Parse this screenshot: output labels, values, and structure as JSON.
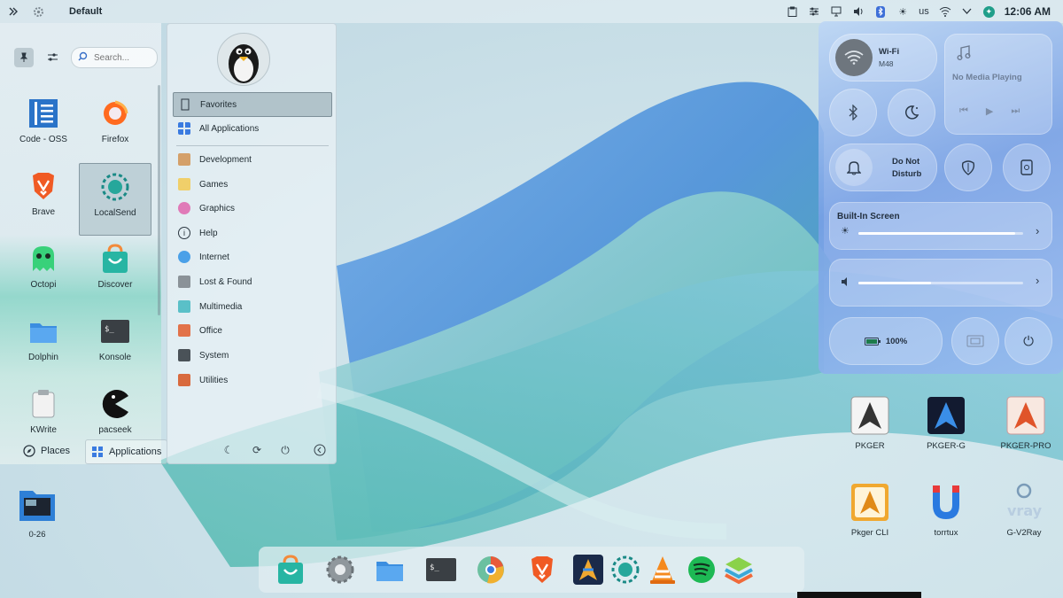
{
  "topbar": {
    "title": "Default",
    "keyboard_layout": "us",
    "clock": "12:06 AM",
    "icons": [
      "clipboard-icon",
      "equalizer-icon",
      "display-icon",
      "volume-icon",
      "bluetooth-icon",
      "brightness-icon",
      "wifi-icon",
      "chevron-down-icon",
      "user-badge-icon"
    ]
  },
  "launcher": {
    "search_placeholder": "Search...",
    "apps": [
      {
        "label": "Code - OSS",
        "icon": "code-oss-icon"
      },
      {
        "label": "Firefox",
        "icon": "firefox-icon"
      },
      {
        "label": "Brave",
        "icon": "brave-icon"
      },
      {
        "label": "LocalSend",
        "icon": "localsend-icon",
        "selected": true
      },
      {
        "label": "Octopi",
        "icon": "octopi-icon"
      },
      {
        "label": "Discover",
        "icon": "discover-icon"
      },
      {
        "label": "Dolphin",
        "icon": "dolphin-icon"
      },
      {
        "label": "Konsole",
        "icon": "konsole-icon"
      },
      {
        "label": "KWrite",
        "icon": "kwrite-icon"
      },
      {
        "label": "pacseek",
        "icon": "pacseek-icon"
      }
    ],
    "tabs": {
      "places": "Places",
      "applications": "Applications"
    },
    "categories": [
      {
        "label": "Favorites",
        "selected": true
      },
      {
        "label": "All Applications"
      },
      {
        "label": "Development"
      },
      {
        "label": "Games"
      },
      {
        "label": "Graphics"
      },
      {
        "label": "Help"
      },
      {
        "label": "Internet"
      },
      {
        "label": "Lost & Found"
      },
      {
        "label": "Multimedia"
      },
      {
        "label": "Office"
      },
      {
        "label": "System"
      },
      {
        "label": "Utilities"
      }
    ]
  },
  "quick_settings": {
    "wifi_label": "Wi-Fi",
    "wifi_network": "M48",
    "media_status": "No Media Playing",
    "dnd_label_1": "Do Not",
    "dnd_label_2": "Disturb",
    "screen_label": "Built-In Screen",
    "brightness": 0.95,
    "volume": 0.44,
    "battery": "100%"
  },
  "desktop_icons": [
    {
      "label": "0-26"
    },
    {
      "label": "PKGER"
    },
    {
      "label": "PKGER-G"
    },
    {
      "label": "PKGER-PRO"
    },
    {
      "label": "Pkger CLI"
    },
    {
      "label": "torrtux"
    },
    {
      "label": "G-V2Ray"
    }
  ],
  "dock": [
    "discover-icon",
    "settings-icon",
    "files-icon",
    "terminal-icon",
    "chromium-icon",
    "brave-icon",
    "pkger-icon",
    "localsend-icon",
    "vlc-icon",
    "spotify-icon",
    "layers-icon"
  ]
}
